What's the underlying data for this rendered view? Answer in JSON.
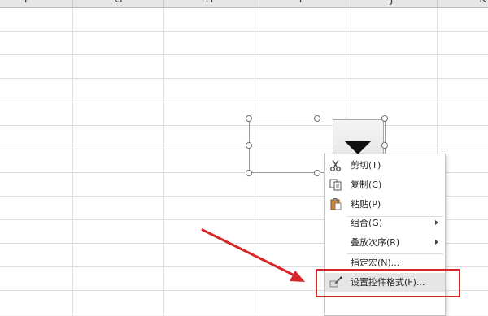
{
  "column_headers": [
    "F",
    "G",
    "H",
    "I",
    "J",
    "K"
  ],
  "context_menu": {
    "items": [
      {
        "label": "剪切(T)",
        "icon": "scissors-icon"
      },
      {
        "label": "复制(C)",
        "icon": "copy-icon"
      },
      {
        "label": "粘贴(P)",
        "icon": "paste-icon"
      },
      {
        "label": "组合(G)",
        "submenu": true
      },
      {
        "label": "叠放次序(R)",
        "submenu": true
      },
      {
        "label": "指定宏(N)..."
      },
      {
        "label": "设置控件格式(F)...",
        "icon": "format-control-icon",
        "highlighted": true
      }
    ]
  },
  "colors": {
    "annotation_red": "#d6262b",
    "grid": "#dedede",
    "menu_highlight": "#e5e5e5"
  }
}
